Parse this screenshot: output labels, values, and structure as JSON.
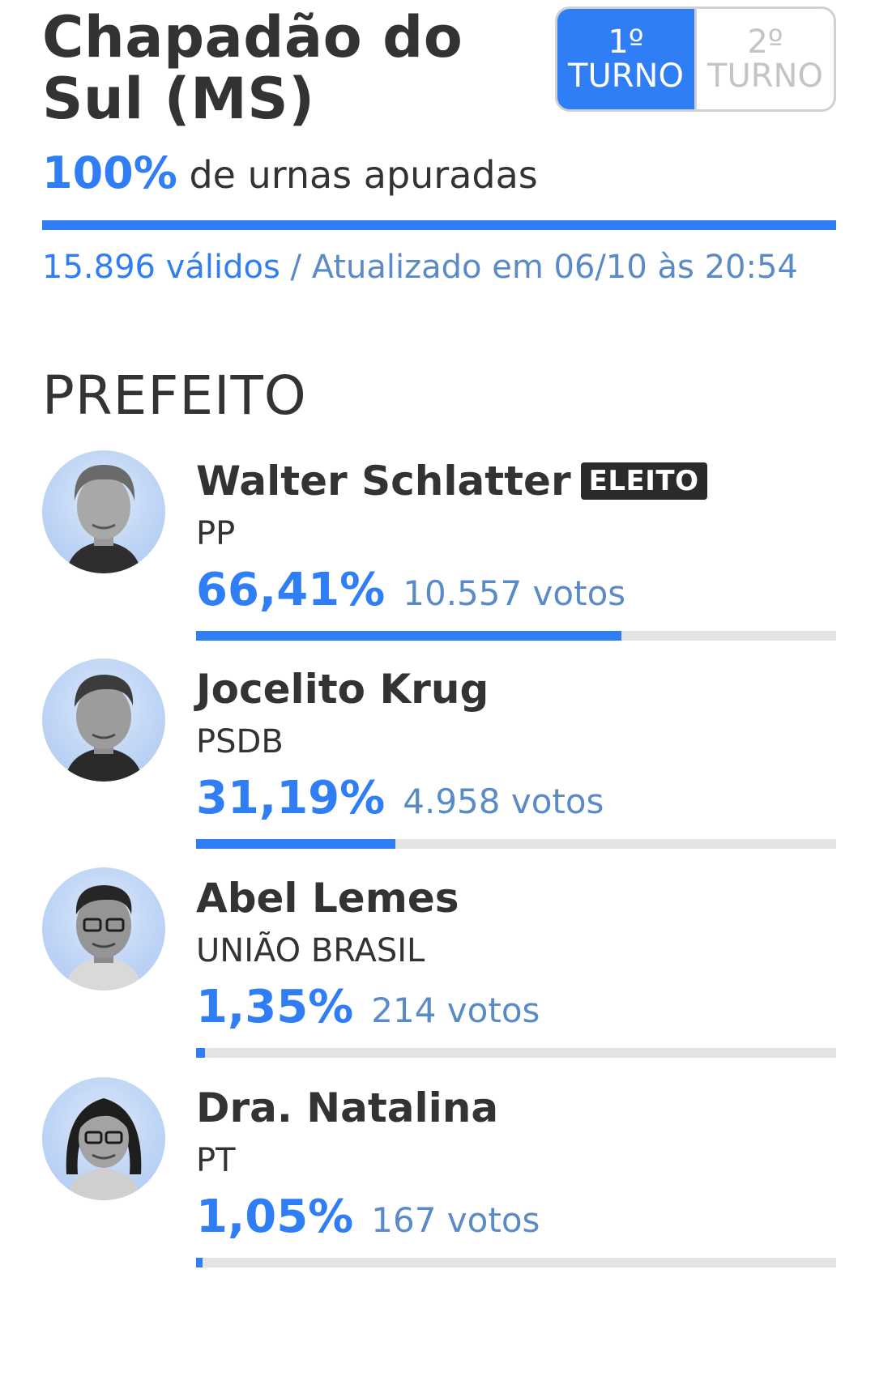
{
  "header": {
    "city": "Chapadão do Sul (MS)",
    "turnos": [
      {
        "label_num": "1º",
        "label_word": "TURNO",
        "active": true
      },
      {
        "label_num": "2º",
        "label_word": "TURNO",
        "active": false
      }
    ]
  },
  "apuracao": {
    "percent_text": "100%",
    "percent": 100,
    "label": " de urnas apuradas"
  },
  "meta": {
    "validos": "15.896 válidos",
    "atualizado": " / Atualizado em 06/10 às 20:54"
  },
  "section": {
    "title": "PREFEITO"
  },
  "candidates": [
    {
      "name": "Walter Schlatter",
      "badge": "ELEITO",
      "party": "PP",
      "percent_text": "66,41%",
      "percent": 66.41,
      "votes": "10.557 votos",
      "avatar_icon": "person-photo-icon"
    },
    {
      "name": "Jocelito Krug",
      "badge": "",
      "party": "PSDB",
      "percent_text": "31,19%",
      "percent": 31.19,
      "votes": "4.958 votos",
      "avatar_icon": "person-photo-icon"
    },
    {
      "name": "Abel Lemes",
      "badge": "",
      "party": "UNIÃO BRASIL",
      "percent_text": "1,35%",
      "percent": 1.35,
      "votes": "214 votos",
      "avatar_icon": "person-photo-icon"
    },
    {
      "name": "Dra. Natalina",
      "badge": "",
      "party": "PT",
      "percent_text": "1,05%",
      "percent": 1.05,
      "votes": "167 votos",
      "avatar_icon": "person-photo-icon"
    }
  ],
  "colors": {
    "accent": "#2f7ef6",
    "text": "#333333",
    "muted_blue": "#5a8bc7",
    "bar_track": "#e4e4e4",
    "badge_bg": "#2b2b2b"
  }
}
